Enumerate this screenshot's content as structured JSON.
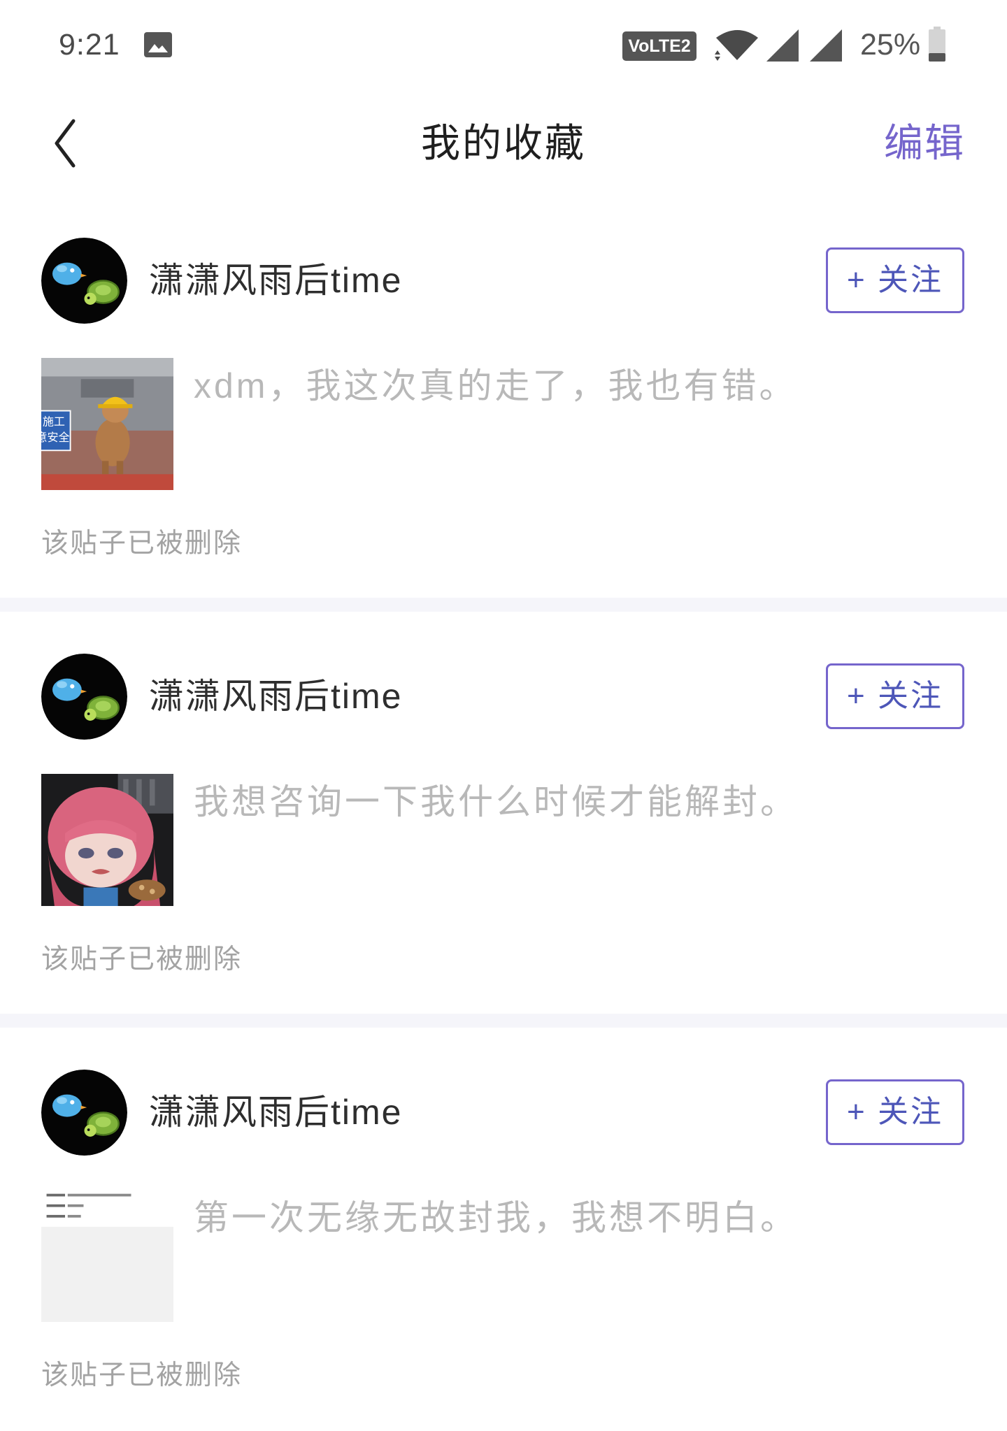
{
  "status_bar": {
    "time": "9:21",
    "network_badge": "VoLTE2",
    "battery_level": "25%",
    "icons": [
      "gallery-icon",
      "volte-icon",
      "wifi-icon",
      "signal-icon",
      "signal-icon",
      "battery-icon"
    ]
  },
  "header": {
    "back_icon": "chevron-left-icon",
    "title": "我的收藏",
    "edit_label": "编辑"
  },
  "colors": {
    "accent": "#7565cc",
    "follow_text": "#4d56b8",
    "post_text": "#b8b8b8",
    "note_text": "#a3a3a3",
    "divider": "#f5f5fa"
  },
  "posts": [
    {
      "username": "潇潇风雨后time",
      "follow_label": "+ 关注",
      "text": "xdm，我这次真的走了，我也有错。",
      "status": "该贴子已被删除",
      "thumbnail": {
        "sign_line1": "施工",
        "sign_line2": "意安全"
      }
    },
    {
      "username": "潇潇风雨后time",
      "follow_label": "+ 关注",
      "text": "我想咨询一下我什么时候才能解封。",
      "status": "该贴子已被删除"
    },
    {
      "username": "潇潇风雨后time",
      "follow_label": "+ 关注",
      "text": "第一次无缘无故封我，我想不明白。",
      "status": "该贴子已被删除"
    }
  ]
}
